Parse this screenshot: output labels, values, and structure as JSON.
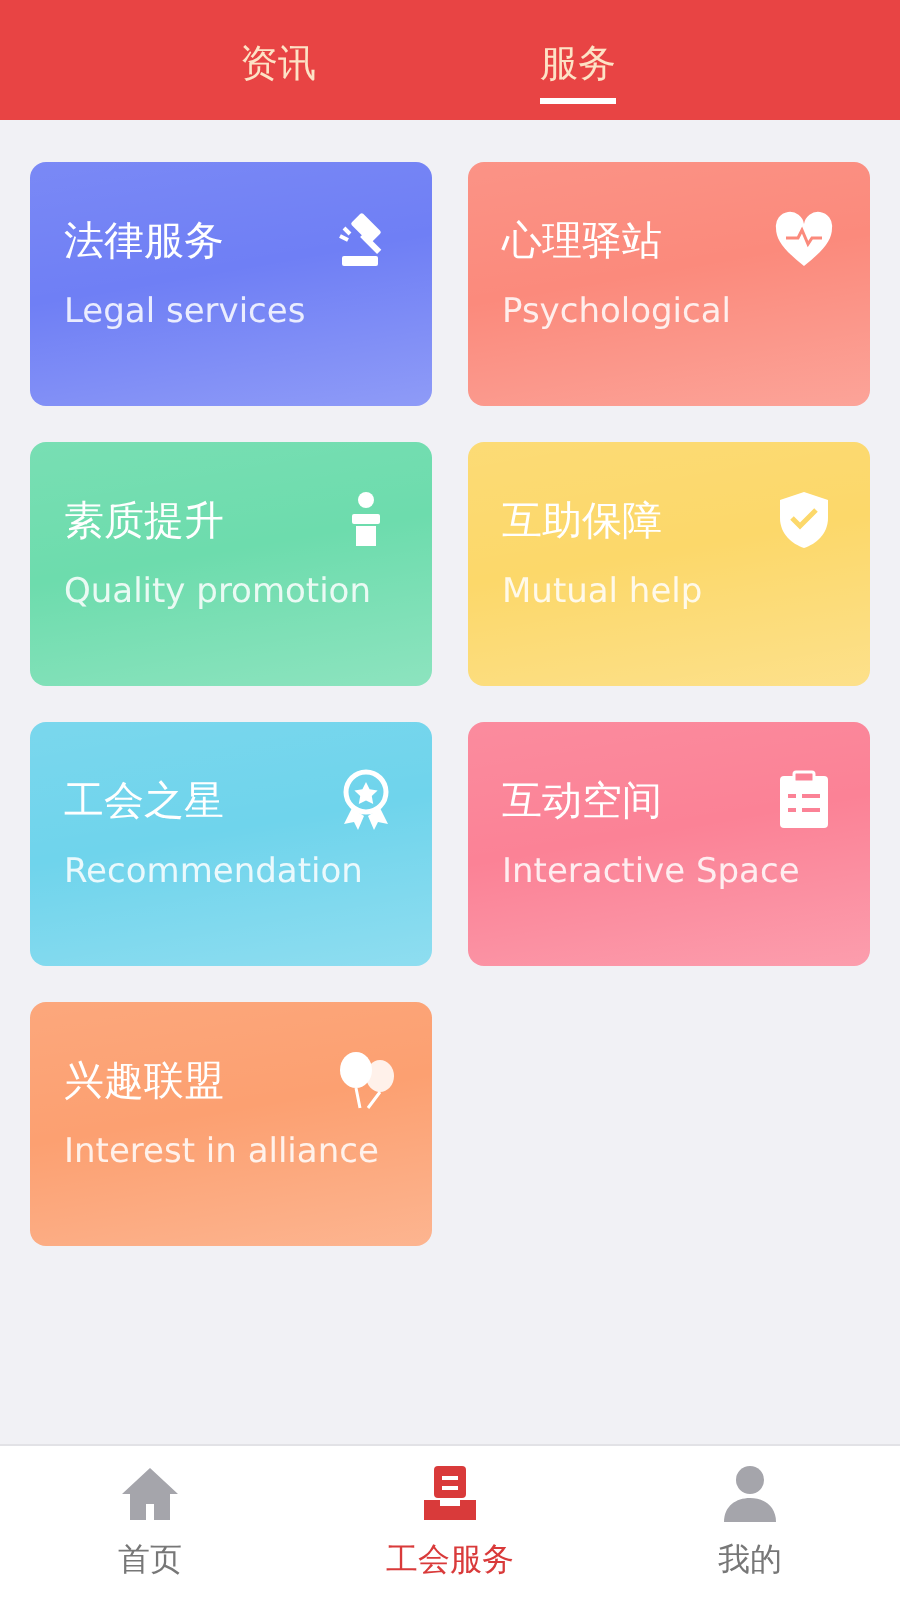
{
  "top_tabs": [
    {
      "label": "资讯",
      "selected": false
    },
    {
      "label": "服务",
      "selected": true
    }
  ],
  "services": [
    {
      "title": "法律服务",
      "subtitle": "Legal services",
      "kind": "gavel",
      "color": "#6f7ff5"
    },
    {
      "title": "心理驿站",
      "subtitle": "Psychological",
      "kind": "heart",
      "color": "#fb8a7c"
    },
    {
      "title": "素质提升",
      "subtitle": "Quality promotion",
      "kind": "podium",
      "color": "#6ddcad"
    },
    {
      "title": "互助保障",
      "subtitle": "Mutual help",
      "kind": "shield",
      "color": "#fcd86a"
    },
    {
      "title": "工会之星",
      "subtitle": "Recommendation",
      "kind": "medal",
      "color": "#6fd4ec"
    },
    {
      "title": "互动空间",
      "subtitle": "Interactive Space",
      "kind": "clipboard",
      "color": "#fb8296"
    },
    {
      "title": "兴趣联盟",
      "subtitle": "Interest in alliance",
      "kind": "balloons",
      "color": "#fca071"
    }
  ],
  "bottom_nav": [
    {
      "label": "首页",
      "kind": "home",
      "selected": false
    },
    {
      "label": "工会服务",
      "kind": "service",
      "selected": true
    },
    {
      "label": "我的",
      "kind": "person",
      "selected": false
    }
  ]
}
